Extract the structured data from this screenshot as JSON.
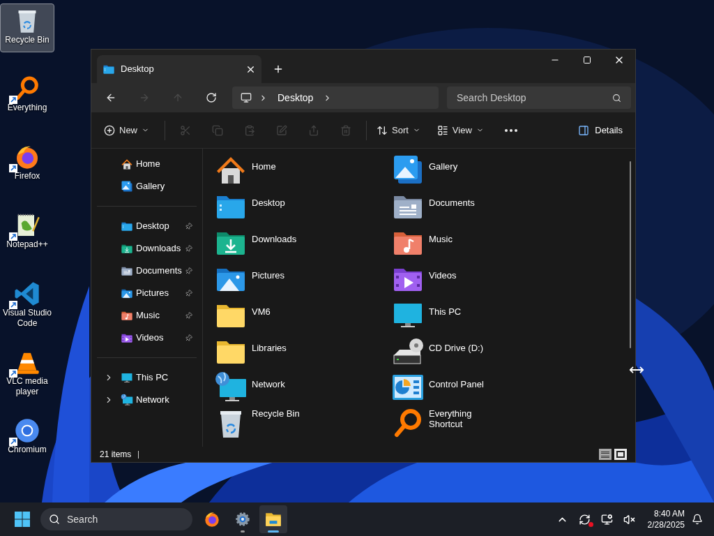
{
  "desktop_icons": [
    {
      "label": "Recycle Bin",
      "kind": "recycle",
      "shortcut": false,
      "selected": true
    },
    {
      "label": "Everything",
      "kind": "everything",
      "shortcut": true,
      "selected": false
    },
    {
      "label": "Firefox",
      "kind": "firefox",
      "shortcut": true,
      "selected": false
    },
    {
      "label": "Notepad++",
      "kind": "notepad",
      "shortcut": true,
      "selected": false
    },
    {
      "label": "Visual Studio Code",
      "kind": "vscode",
      "shortcut": true,
      "selected": false
    },
    {
      "label": "VLC media player",
      "kind": "vlc",
      "shortcut": true,
      "selected": false
    },
    {
      "label": "Chromium",
      "kind": "chromium",
      "shortcut": true,
      "selected": false
    }
  ],
  "window": {
    "tab": {
      "title": "Desktop",
      "kind": "desktop"
    },
    "nav": [
      {
        "kind": "back",
        "disabled": false
      },
      {
        "kind": "forward",
        "disabled": true
      },
      {
        "kind": "up",
        "disabled": true
      },
      {
        "kind": "refresh",
        "disabled": false
      }
    ],
    "address": {
      "crumbs": [
        "Desktop"
      ]
    },
    "search": {
      "placeholder": "Search Desktop"
    },
    "toolbar": [
      {
        "kind": "new",
        "label": "New",
        "disabled": false
      },
      {
        "kind": "cut",
        "disabled": true
      },
      {
        "kind": "copy",
        "disabled": true
      },
      {
        "kind": "paste",
        "disabled": true
      },
      {
        "kind": "rename",
        "disabled": true
      },
      {
        "kind": "share",
        "disabled": true
      },
      {
        "kind": "delete",
        "disabled": true
      },
      {
        "kind": "sort",
        "label": "Sort",
        "disabled": false
      },
      {
        "kind": "view",
        "label": "View",
        "disabled": false
      },
      {
        "kind": "more",
        "disabled": false
      }
    ],
    "details": {
      "label": "Details"
    },
    "sidebar": [
      [
        {
          "label": "Home",
          "kind": "home",
          "pinned": false,
          "expandable": false
        },
        {
          "label": "Gallery",
          "kind": "gallery",
          "pinned": false,
          "expandable": false
        }
      ],
      [
        {
          "label": "Desktop",
          "kind": "desktop",
          "pinned": true,
          "expandable": false
        },
        {
          "label": "Downloads",
          "kind": "downloads",
          "pinned": true,
          "expandable": false
        },
        {
          "label": "Documents",
          "kind": "documents",
          "pinned": true,
          "expandable": false
        },
        {
          "label": "Pictures",
          "kind": "pictures",
          "pinned": true,
          "expandable": false
        },
        {
          "label": "Music",
          "kind": "music",
          "pinned": true,
          "expandable": false
        },
        {
          "label": "Videos",
          "kind": "videos",
          "pinned": true,
          "expandable": false
        }
      ],
      [
        {
          "label": "This PC",
          "kind": "monitor",
          "pinned": false,
          "expandable": true
        },
        {
          "label": "Network",
          "kind": "network",
          "pinned": false,
          "expandable": true
        }
      ]
    ],
    "items": [
      {
        "label": "Home",
        "kind": "home"
      },
      {
        "label": "Gallery",
        "kind": "gallery"
      },
      {
        "label": "Desktop",
        "kind": "desktop"
      },
      {
        "label": "Documents",
        "kind": "documents"
      },
      {
        "label": "Downloads",
        "kind": "downloads"
      },
      {
        "label": "Music",
        "kind": "music"
      },
      {
        "label": "Pictures",
        "kind": "pictures"
      },
      {
        "label": "Videos",
        "kind": "videos"
      },
      {
        "label": "VM6",
        "kind": "folder"
      },
      {
        "label": "This PC",
        "kind": "monitor"
      },
      {
        "label": "Libraries",
        "kind": "folder"
      },
      {
        "label": "CD Drive (D:)",
        "kind": "cd"
      },
      {
        "label": "Network",
        "kind": "network"
      },
      {
        "label": "Control Panel",
        "kind": "control"
      },
      {
        "label": "Recycle Bin",
        "kind": "recycle"
      },
      {
        "label": "Everything Shortcut",
        "kind": "everything"
      }
    ],
    "status": "21 items",
    "view_buttons": [
      {
        "kind": "details",
        "selected": false
      },
      {
        "kind": "tiles",
        "selected": true
      }
    ]
  },
  "taskbar": {
    "search": {
      "placeholder": "Search"
    },
    "apps": [
      {
        "kind": "firefox",
        "active": false,
        "running": false
      },
      {
        "kind": "settings",
        "active": false,
        "running": true
      },
      {
        "kind": "explorer",
        "active": true,
        "running": true
      }
    ],
    "time": "8:40 AM",
    "date": "2/28/2025"
  }
}
